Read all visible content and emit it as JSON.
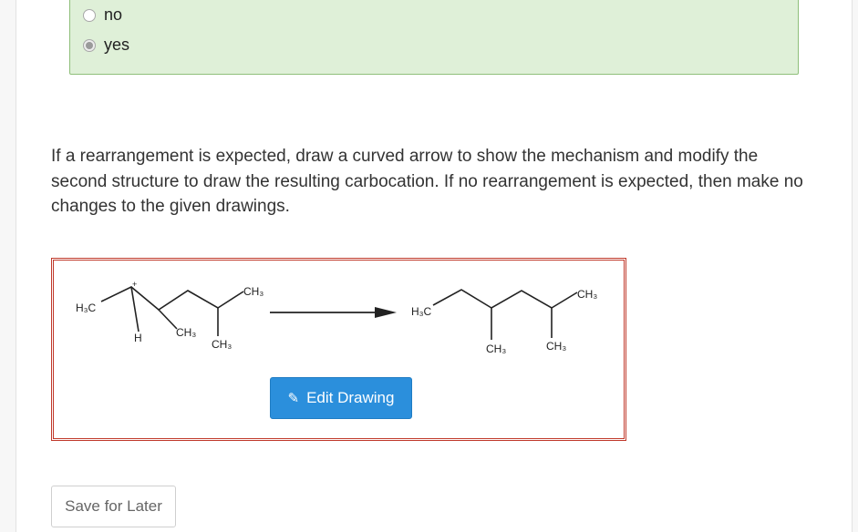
{
  "options": [
    {
      "label": "no",
      "selected": false
    },
    {
      "label": "yes",
      "selected": true
    }
  ],
  "question_text": "If a rearrangement is expected, draw a curved arrow to show the mechanism and modify the second structure to draw the resulting carbocation. If no rearrangement is expected, then make no changes to the given drawings.",
  "drawing": {
    "reactant": {
      "h3c": "H3C",
      "charge": "+",
      "h": "H",
      "ch3_a": "CH3",
      "ch3_b": "CH3",
      "ch3_top": "CH3"
    },
    "product": {
      "h3c": "H3C",
      "ch3_top": "CH3",
      "ch3_a": "CH3",
      "ch3_b": "CH3"
    },
    "edit_button_label": "Edit Drawing"
  },
  "save_later_label": "Save for Later",
  "colors": {
    "answer_bg": "#dff0d8",
    "answer_border": "#8fbf7a",
    "frame_border": "#c0392b",
    "edit_button_bg": "#2b8fdc"
  }
}
